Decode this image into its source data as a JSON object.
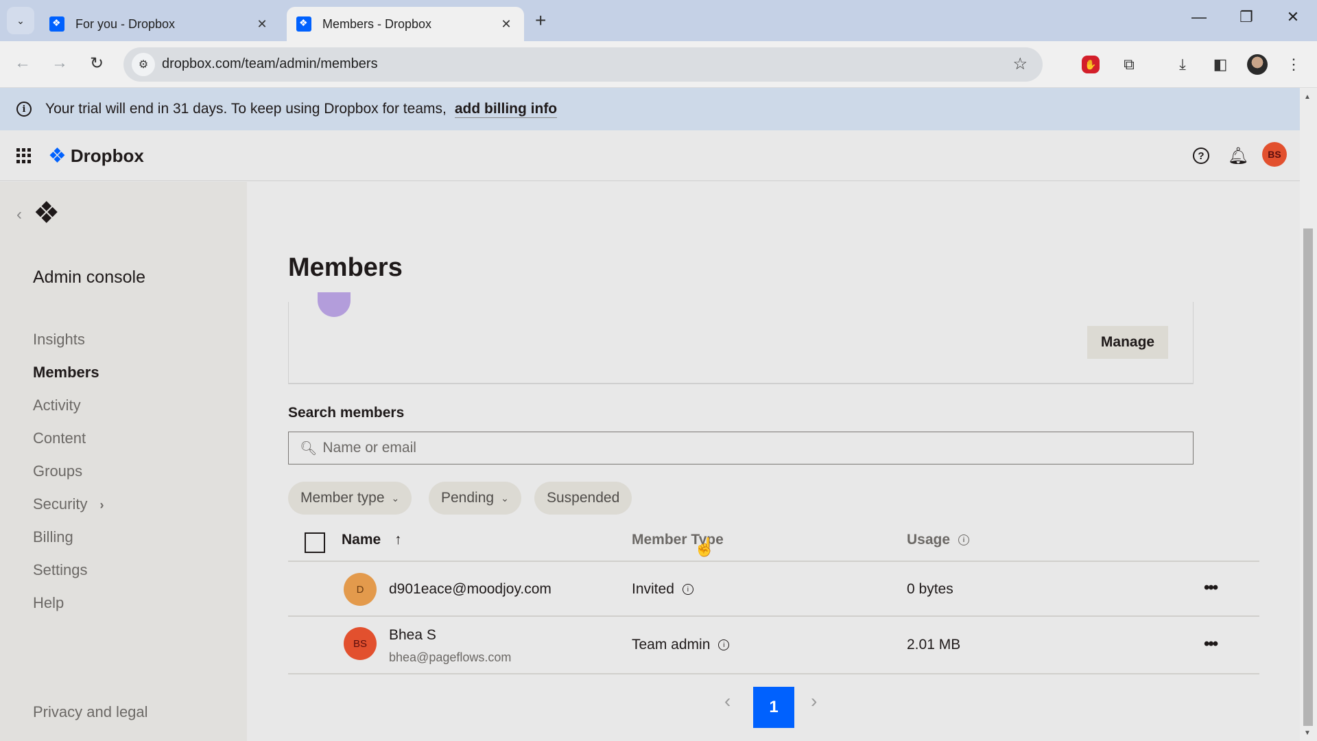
{
  "browser": {
    "tabs": [
      {
        "label": "For you - Dropbox",
        "active": false
      },
      {
        "label": "Members - Dropbox",
        "active": true
      }
    ],
    "url": "dropbox.com/team/admin/members",
    "icons": {
      "tab_search": "chevron-down",
      "new_tab": "+",
      "back": "←",
      "forward": "→",
      "reload": "↻",
      "minimize": "—",
      "restore": "❐",
      "close": "✕"
    }
  },
  "banner": {
    "text": "Your trial will end in 31 days. To keep using Dropbox for teams,",
    "link": "add billing info"
  },
  "header": {
    "brand": "Dropbox",
    "user_initials": "BS",
    "avatar_color": "#e2502e"
  },
  "sidebar": {
    "title": "Admin console",
    "items": [
      {
        "label": "Insights",
        "active": false
      },
      {
        "label": "Members",
        "active": true
      },
      {
        "label": "Activity",
        "active": false
      },
      {
        "label": "Content",
        "active": false
      },
      {
        "label": "Groups",
        "active": false
      },
      {
        "label": "Security",
        "active": false,
        "has_submenu": true
      },
      {
        "label": "Billing",
        "active": false
      },
      {
        "label": "Settings",
        "active": false
      },
      {
        "label": "Help",
        "active": false
      }
    ],
    "footer_link": "Privacy and legal"
  },
  "main": {
    "title": "Members",
    "manage_label": "Manage",
    "search": {
      "label": "Search members",
      "placeholder": "Name or email",
      "value": ""
    },
    "filters": [
      {
        "label": "Member type",
        "dropdown": true
      },
      {
        "label": "Pending",
        "dropdown": true
      },
      {
        "label": "Suspended",
        "dropdown": false
      }
    ],
    "table": {
      "columns": {
        "name": "Name",
        "member_type": "Member Type",
        "usage": "Usage"
      },
      "sort": "ascending",
      "rows": [
        {
          "initials": "D",
          "avatar_color": "#e39a4c",
          "name": "d901eace@moodjoy.com",
          "email": "",
          "member_type": "Invited",
          "usage": "0 bytes"
        },
        {
          "initials": "BS",
          "avatar_color": "#e2502e",
          "name": "Bhea S",
          "email": "bhea@pageflows.com",
          "member_type": "Team admin",
          "usage": "2.01 MB"
        }
      ]
    },
    "pagination": {
      "current_page": "1",
      "page_color": "#0061fe"
    }
  }
}
